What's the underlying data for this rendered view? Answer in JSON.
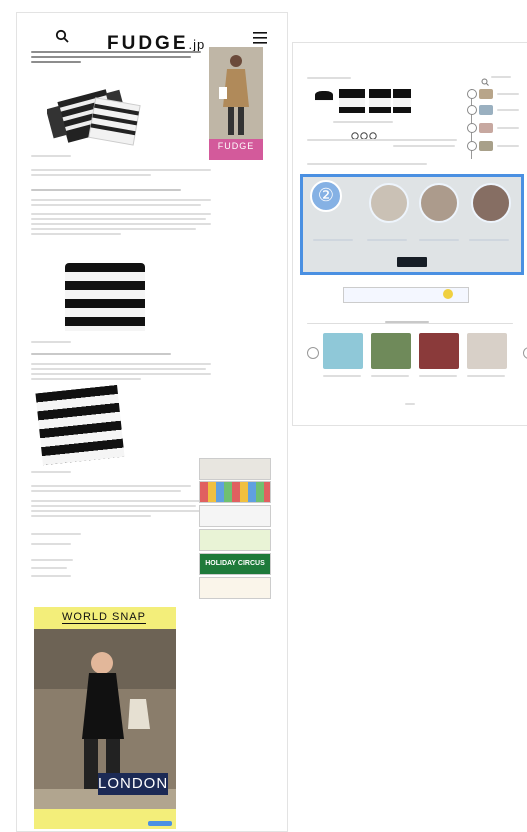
{
  "mobile": {
    "logo": "FUDGE",
    "logo_suffix": ".jp",
    "side_ad_title": "FUDGE",
    "snap_ad": {
      "title": "WORLD SNAP",
      "city": "LONDON"
    },
    "banners": [
      "HOLIDAY CIRCUS"
    ]
  },
  "desktop": {
    "badge_number": "②"
  },
  "colors": {
    "highlight": "#4a90e2",
    "snap_bg": "#f3ee7a",
    "london_bg": "#1c2a55",
    "holiday_green": "#1e7a3a",
    "fudge_pink": "#d35a9b"
  }
}
